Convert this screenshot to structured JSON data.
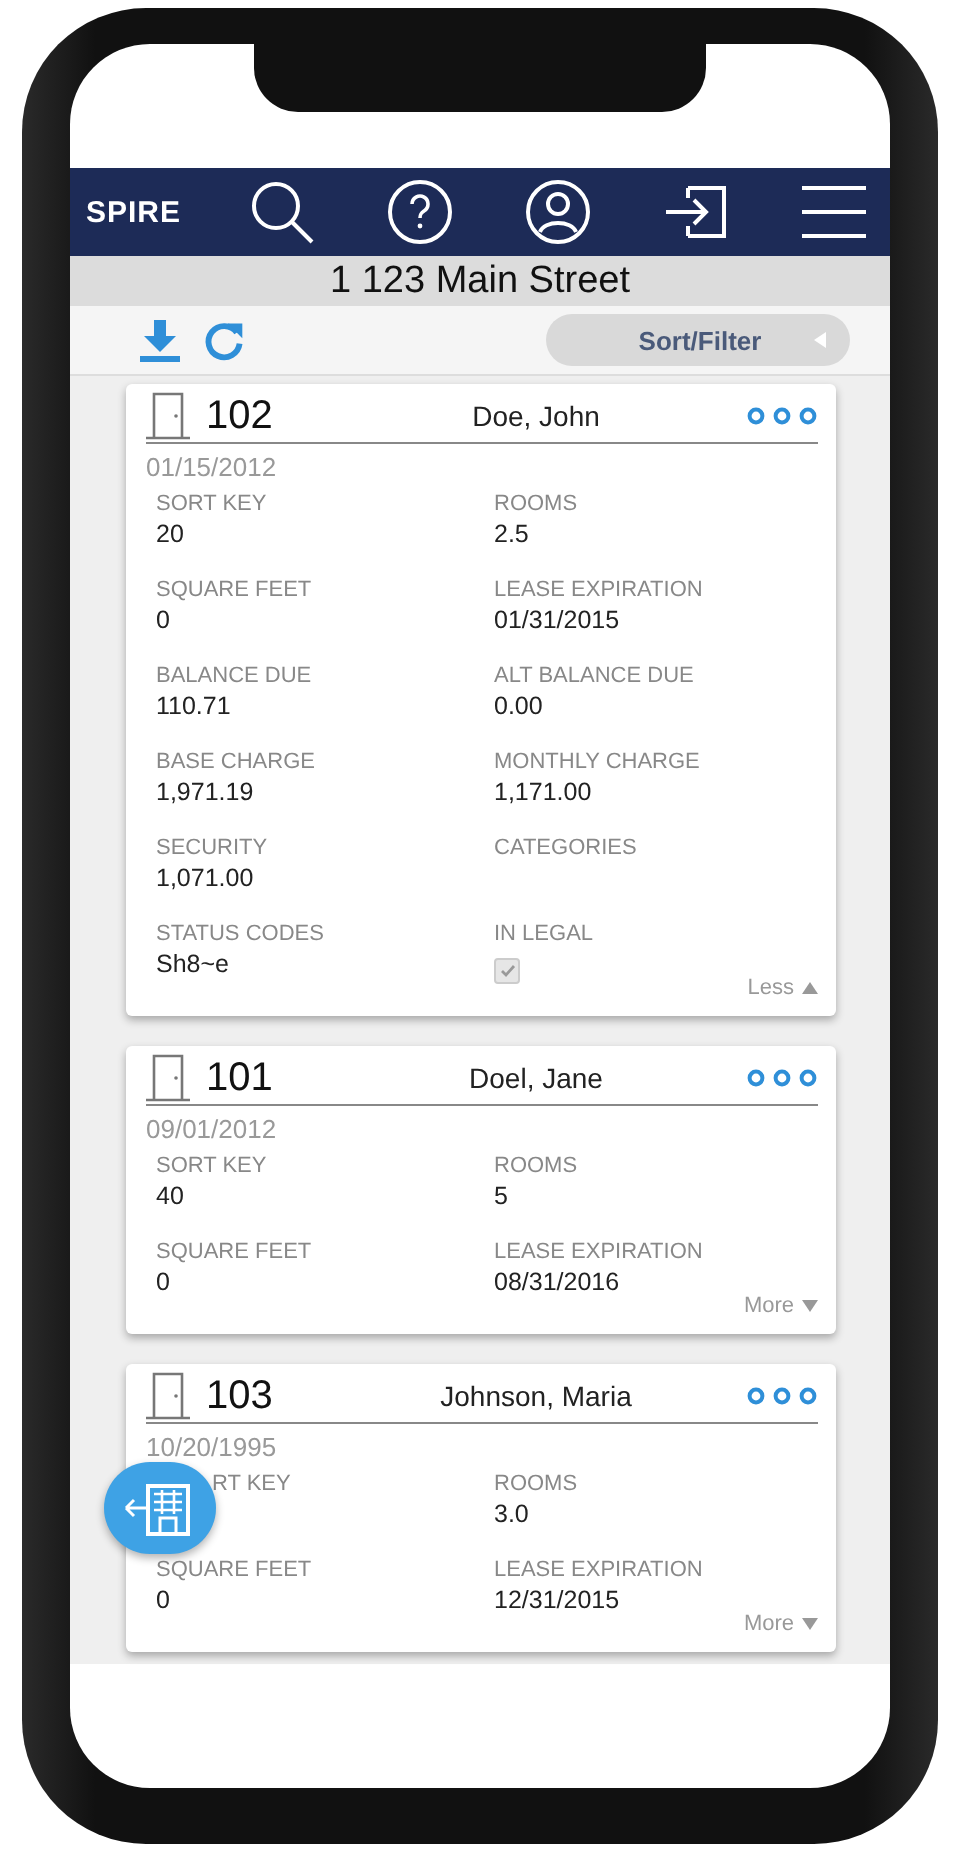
{
  "header": {
    "logo": "SPIRE"
  },
  "address": "1 123 Main Street",
  "toolbar": {
    "sort_filter": "Sort/Filter"
  },
  "cards": [
    {
      "unit": "102",
      "tenant": "Doe, John",
      "date": "01/15/2012",
      "expanded": true,
      "toggle": "Less",
      "fields": [
        {
          "kind": "text",
          "label": "SORT KEY",
          "value": "20"
        },
        {
          "kind": "text",
          "label": "ROOMS",
          "value": "2.5"
        },
        {
          "kind": "text",
          "label": "SQUARE FEET",
          "value": "0"
        },
        {
          "kind": "text",
          "label": "LEASE EXPIRATION",
          "value": "01/31/2015"
        },
        {
          "kind": "text",
          "label": "BALANCE DUE",
          "value": "110.71"
        },
        {
          "kind": "text",
          "label": "ALT BALANCE DUE",
          "value": "0.00"
        },
        {
          "kind": "text",
          "label": "BASE CHARGE",
          "value": "1,971.19"
        },
        {
          "kind": "text",
          "label": "MONTHLY CHARGE",
          "value": "1,171.00"
        },
        {
          "kind": "text",
          "label": "SECURITY",
          "value": "1,071.00"
        },
        {
          "kind": "text",
          "label": "CATEGORIES"
        },
        {
          "kind": "text",
          "label": "STATUS CODES",
          "value": "Sh8~e"
        },
        {
          "kind": "checkbox",
          "label": "IN LEGAL",
          "checked": true
        }
      ]
    },
    {
      "unit": "101",
      "tenant": "Doel, Jane",
      "date": "09/01/2012",
      "expanded": false,
      "toggle": "More",
      "fields": [
        {
          "kind": "text",
          "label": "SORT KEY",
          "value": "40"
        },
        {
          "kind": "text",
          "label": "ROOMS",
          "value": "5"
        },
        {
          "kind": "text",
          "label": "SQUARE FEET",
          "value": "0"
        },
        {
          "kind": "text",
          "label": "LEASE EXPIRATION",
          "value": "08/31/2016"
        }
      ]
    },
    {
      "unit": "103",
      "tenant": "Johnson, Maria",
      "date": "10/20/1995",
      "expanded": false,
      "toggle": "More",
      "fields": [
        {
          "kind": "text",
          "label": "RT KEY"
        },
        {
          "kind": "text",
          "label": "ROOMS",
          "value": "3.0"
        },
        {
          "kind": "text",
          "label": "SQUARE FEET",
          "value": "0"
        },
        {
          "kind": "text",
          "label": "LEASE EXPIRATION",
          "value": "12/31/2015"
        }
      ]
    }
  ]
}
